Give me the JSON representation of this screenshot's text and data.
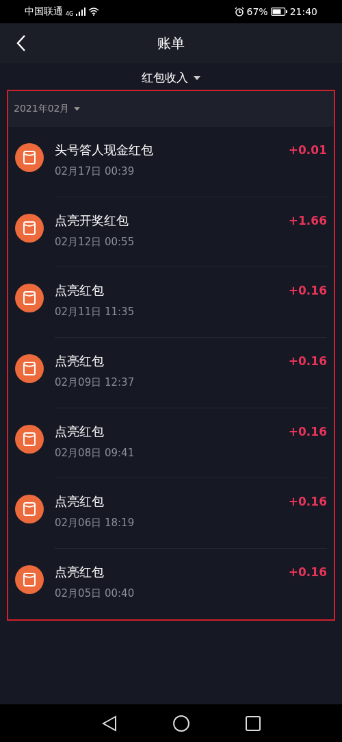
{
  "status_bar": {
    "carrier": "中国联通",
    "network": "4G",
    "battery": "67%",
    "time": "21:40"
  },
  "header": {
    "title": "账单"
  },
  "filter": {
    "label": "红包收入"
  },
  "month": {
    "label": "2021年02月"
  },
  "items": [
    {
      "title": "头号答人现金红包",
      "date": "02月17日 00:39",
      "amount": "+0.01"
    },
    {
      "title": "点亮开奖红包",
      "date": "02月12日 00:55",
      "amount": "+1.66"
    },
    {
      "title": "点亮红包",
      "date": "02月11日 11:35",
      "amount": "+0.16"
    },
    {
      "title": "点亮红包",
      "date": "02月09日 12:37",
      "amount": "+0.16"
    },
    {
      "title": "点亮红包",
      "date": "02月08日 09:41",
      "amount": "+0.16"
    },
    {
      "title": "点亮红包",
      "date": "02月06日 18:19",
      "amount": "+0.16"
    },
    {
      "title": "点亮红包",
      "date": "02月05日 00:40",
      "amount": "+0.16"
    }
  ]
}
